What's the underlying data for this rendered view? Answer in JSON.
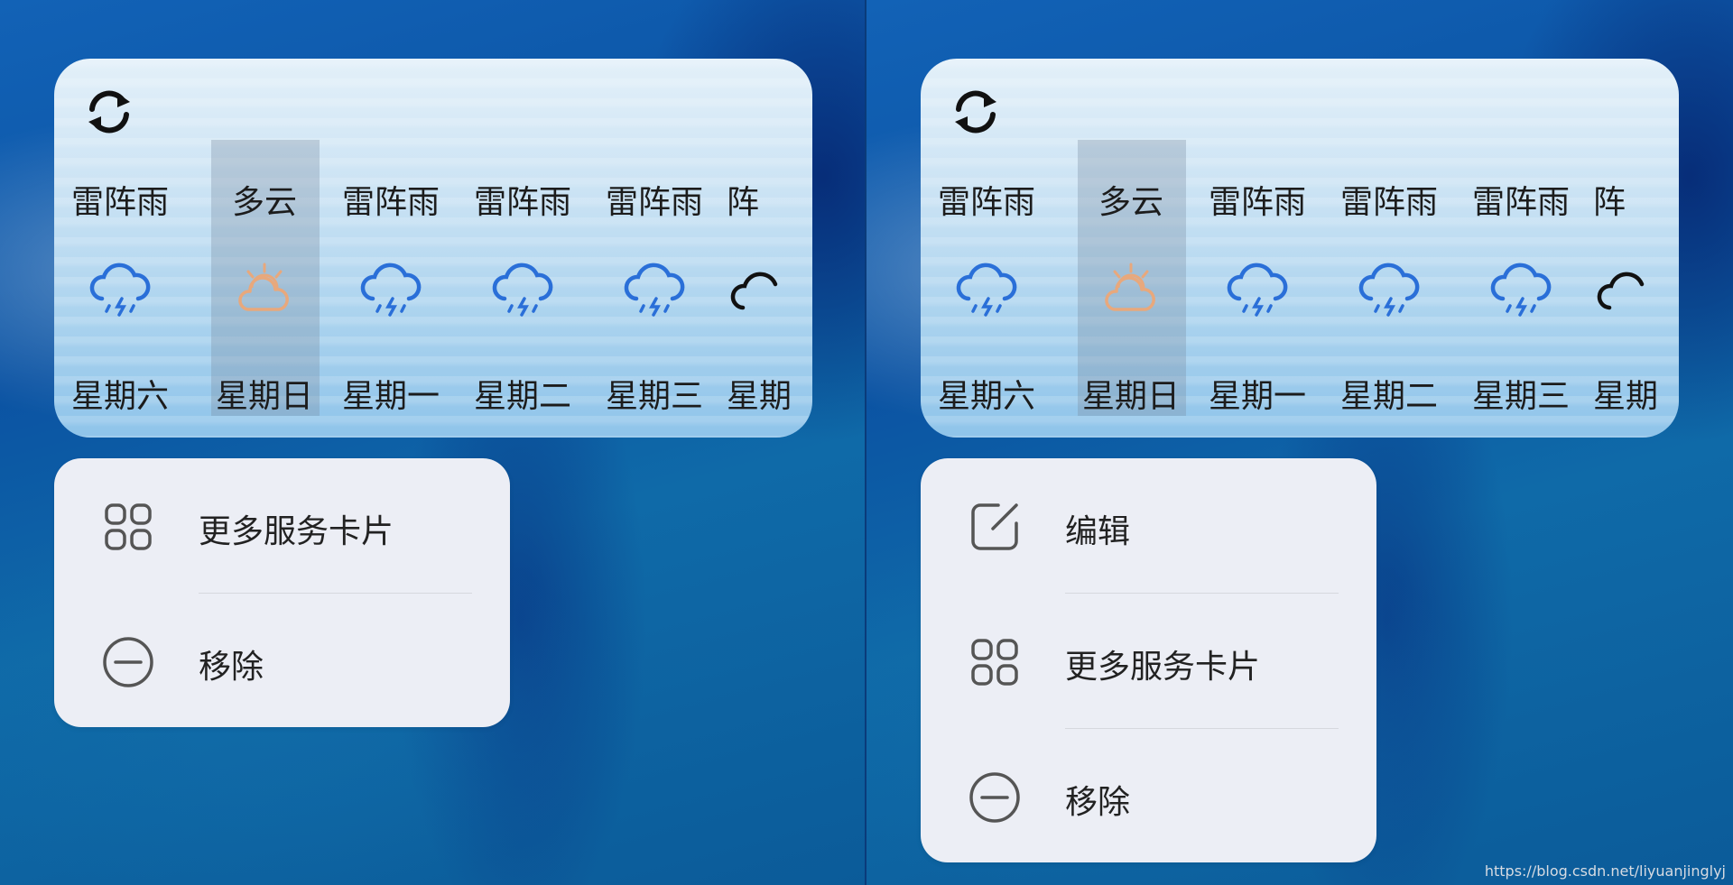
{
  "panels": [
    {
      "weather": {
        "days": [
          {
            "condition": "雷阵雨",
            "day": "星期六",
            "icon": "thunderstorm-icon"
          },
          {
            "condition": "多云",
            "day": "星期日",
            "icon": "partly-cloudy-icon"
          },
          {
            "condition": "雷阵雨",
            "day": "星期一",
            "icon": "thunderstorm-icon"
          },
          {
            "condition": "雷阵雨",
            "day": "星期二",
            "icon": "thunderstorm-icon"
          },
          {
            "condition": "雷阵雨",
            "day": "星期三",
            "icon": "thunderstorm-icon"
          },
          {
            "condition": "阵",
            "day": "星期",
            "icon": "cloud-icon"
          }
        ]
      },
      "menu": [
        {
          "label": "更多服务卡片",
          "icon": "grid-icon"
        },
        {
          "label": "移除",
          "icon": "remove-icon"
        }
      ]
    },
    {
      "weather": {
        "days": [
          {
            "condition": "雷阵雨",
            "day": "星期六",
            "icon": "thunderstorm-icon"
          },
          {
            "condition": "多云",
            "day": "星期日",
            "icon": "partly-cloudy-icon"
          },
          {
            "condition": "雷阵雨",
            "day": "星期一",
            "icon": "thunderstorm-icon"
          },
          {
            "condition": "雷阵雨",
            "day": "星期二",
            "icon": "thunderstorm-icon"
          },
          {
            "condition": "雷阵雨",
            "day": "星期三",
            "icon": "thunderstorm-icon"
          },
          {
            "condition": "阵",
            "day": "星期",
            "icon": "cloud-icon"
          }
        ]
      },
      "menu": [
        {
          "label": "编辑",
          "icon": "edit-icon"
        },
        {
          "label": "更多服务卡片",
          "icon": "grid-icon"
        },
        {
          "label": "移除",
          "icon": "remove-icon"
        }
      ]
    }
  ],
  "watermark": "https://blog.csdn.net/liyuanjinglyj",
  "colors": {
    "accent_blue": "#2a6fd8",
    "sun_orange": "#e8a87c"
  }
}
